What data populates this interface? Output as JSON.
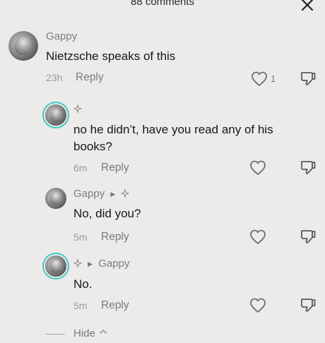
{
  "header": {
    "title": "88 comments"
  },
  "comments": [
    {
      "username": "Gappy",
      "text": "Nietzsche speaks of this",
      "time": "23h",
      "reply_label": "Reply",
      "like_count": "1"
    },
    {
      "username": "",
      "text": "no he didn’t, have you read any of his books?",
      "time": "6m",
      "reply_label": "Reply"
    },
    {
      "username": "Gappy",
      "text": "No, did you?",
      "time": "5m",
      "reply_label": "Reply"
    },
    {
      "reply_to": "Gappy",
      "text": "No.",
      "time": "5m",
      "reply_label": "Reply"
    }
  ],
  "footer": {
    "hide_label": "Hide"
  },
  "colors": {
    "background": "#ecebea",
    "avatar_ring": "#3fc9c4",
    "muted_text": "#7a7a7a"
  },
  "icons": [
    "close-icon",
    "heart-icon",
    "dislike-icon",
    "flair-icon",
    "reply-arrow-icon",
    "chevron-up-icon"
  ]
}
